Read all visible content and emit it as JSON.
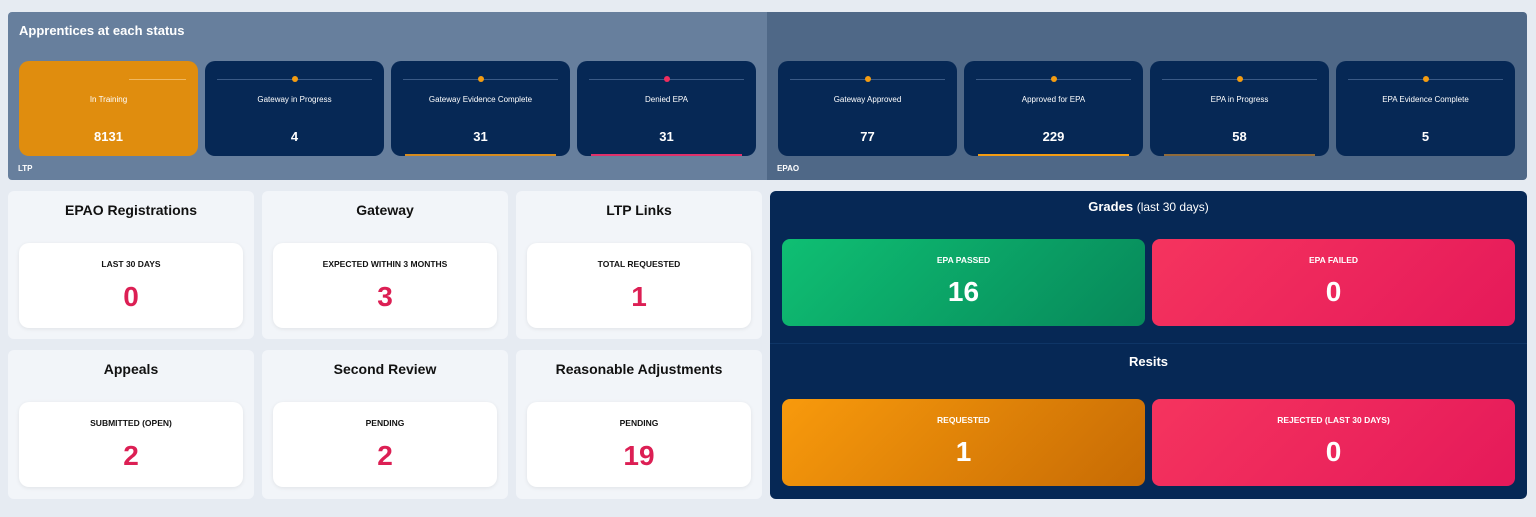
{
  "status_section": {
    "title": "Apprentices at each status",
    "ltp_label": "LTP",
    "epao_label": "EPAO",
    "colors": {
      "active": "#e08d0e",
      "card": "#062855",
      "dot_orange": "#f39c12",
      "dot_red": "#ef2d5e"
    },
    "ltp_cards": [
      {
        "label": "In Training",
        "value": "8131"
      },
      {
        "label": "Gateway in Progress",
        "value": "4"
      },
      {
        "label": "Gateway Evidence Complete",
        "value": "31"
      },
      {
        "label": "Denied EPA",
        "value": "31"
      }
    ],
    "epao_cards": [
      {
        "label": "Gateway Approved",
        "value": "77"
      },
      {
        "label": "Approved for EPA",
        "value": "229"
      },
      {
        "label": "EPA in Progress",
        "value": "58"
      },
      {
        "label": "EPA Evidence Complete",
        "value": "5"
      }
    ]
  },
  "panels": {
    "epao_registrations": {
      "title": "EPAO Registrations",
      "label": "LAST 30 DAYS",
      "value": "0"
    },
    "gateway": {
      "title": "Gateway",
      "label": "EXPECTED WITHIN 3 MONTHS",
      "value": "3"
    },
    "ltp_links": {
      "title": "LTP Links",
      "label": "TOTAL REQUESTED",
      "value": "1"
    },
    "appeals": {
      "title": "Appeals",
      "label": "SUBMITTED (OPEN)",
      "value": "2"
    },
    "second_review": {
      "title": "Second Review",
      "label": "PENDING",
      "value": "2"
    },
    "reasonable_adjustments": {
      "title": "Reasonable Adjustments",
      "label": "PENDING",
      "value": "19"
    }
  },
  "grades": {
    "title": "Grades",
    "subtitle": "(last 30 days)",
    "passed": {
      "label": "EPA PASSED",
      "value": "16"
    },
    "failed": {
      "label": "EPA FAILED",
      "value": "0"
    }
  },
  "resits": {
    "title": "Resits",
    "requested": {
      "label": "REQUESTED",
      "value": "1"
    },
    "rejected": {
      "label": "REJECTED (LAST 30 DAYS)",
      "value": "0"
    }
  }
}
